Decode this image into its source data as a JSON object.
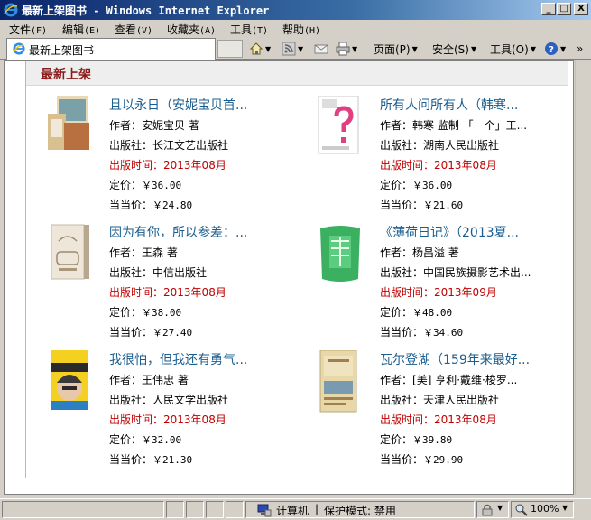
{
  "window": {
    "title": "最新上架图书 - Windows Internet Explorer",
    "min_label": "_",
    "max_label": "□",
    "close_label": "X"
  },
  "menu": [
    {
      "label": "文件",
      "acc": "(F)"
    },
    {
      "label": "编辑",
      "acc": "(E)"
    },
    {
      "label": "查看",
      "acc": "(V)"
    },
    {
      "label": "收藏夹",
      "acc": "(A)"
    },
    {
      "label": "工具",
      "acc": "(T)"
    },
    {
      "label": "帮助",
      "acc": "(H)"
    }
  ],
  "tab": {
    "label": "最新上架图书"
  },
  "commands": {
    "page": "页面(P)",
    "safety": "安全(S)",
    "tools": "工具(O)",
    "more": "»"
  },
  "panel": {
    "title": "最新上架"
  },
  "labels": {
    "author": "作者：",
    "publisher": "出版社：",
    "pubdate": "出版时间：",
    "list_price": "定价：",
    "sale_price": "当当价："
  },
  "books": [
    {
      "title": "且以永日（安妮宝贝首...",
      "author": "安妮宝贝  著",
      "publisher": "长江文艺出版社",
      "pubdate": "2013年08月",
      "list_price": "￥36.00",
      "sale_price": "￥24.80"
    },
    {
      "title": "所有人问所有人（韩寒...",
      "author": "韩寒 监制 「一个」工...",
      "publisher": "湖南人民出版社",
      "pubdate": "2013年08月",
      "list_price": "￥36.00",
      "sale_price": "￥21.60"
    },
    {
      "title": "因为有你，所以参差：...",
      "author": "王森  著",
      "publisher": "中信出版社",
      "pubdate": "2013年08月",
      "list_price": "￥38.00",
      "sale_price": "￥27.40"
    },
    {
      "title": "《薄荷日记》（2013夏...",
      "author": "杨昌溢  著",
      "publisher": "中国民族摄影艺术出...",
      "pubdate": "2013年09月",
      "list_price": "￥48.00",
      "sale_price": "￥34.60"
    },
    {
      "title": "我很怕，但我还有勇气...",
      "author": "王伟忠  著",
      "publisher": "人民文学出版社",
      "pubdate": "2013年08月",
      "list_price": "￥32.00",
      "sale_price": "￥21.30"
    },
    {
      "title": "瓦尔登湖（159年来最好...",
      "author": "[美] 亨利·戴维·梭罗...",
      "publisher": "天津人民出版社",
      "pubdate": "2013年08月",
      "list_price": "￥39.80",
      "sale_price": "￥29.90"
    }
  ],
  "status": {
    "zone": "计算机",
    "protected": "保护模式: 禁用",
    "zoom": "100%"
  },
  "colors": {
    "title_link": "#1a5d8f",
    "pubdate": "#c00000",
    "panel_title": "#8b1a1a"
  }
}
